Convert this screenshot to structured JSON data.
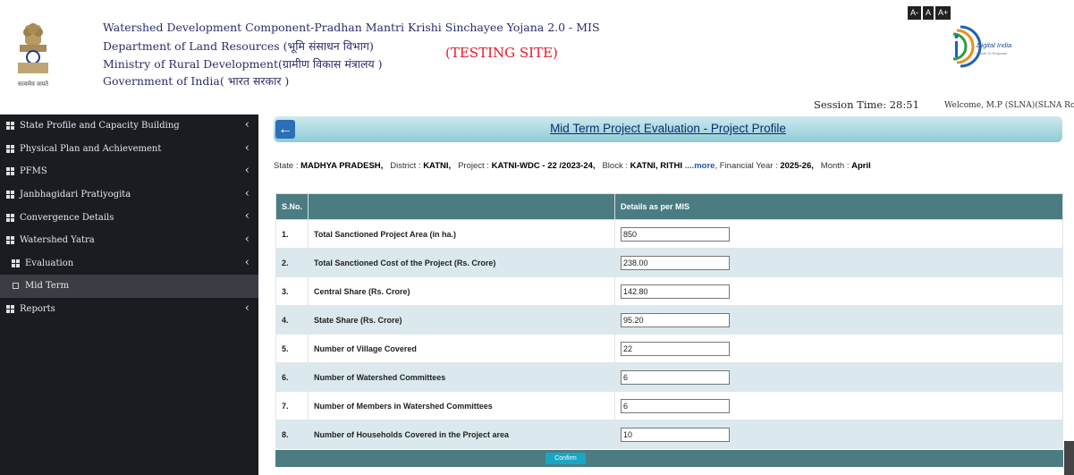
{
  "header": {
    "line1": "Watershed Development Component-Pradhan Mantri Krishi Sinchayee Yojana 2.0 - MIS",
    "line2": "Department of Land Resources (भूमि संसाधन विभाग)",
    "line3": "Ministry of Rural Development(ग्रामीण विकास मंत्रालय )",
    "line4": "Government of India( भारत सरकार )",
    "testing": "(TESTING SITE)",
    "emblem_caption": "सत्यमेव जयते",
    "font_buttons": [
      "A-",
      "A",
      "A+"
    ],
    "digital_india": "Digital India",
    "digital_india_tag": "Power To Empower",
    "session": "Session Time: 28:51",
    "welcome": "Welcome, M.P (SLNA)(SLNA Role) ▾"
  },
  "sidebar": {
    "items": [
      {
        "label": "State Profile and Capacity Building"
      },
      {
        "label": "Physical Plan and Achievement"
      },
      {
        "label": "PFMS"
      },
      {
        "label": "Janbhagidari Pratiyogita"
      },
      {
        "label": "Convergence Details"
      },
      {
        "label": "Watershed Yatra"
      },
      {
        "label": "Evaluation"
      },
      {
        "label": "Mid Term"
      },
      {
        "label": "Reports"
      }
    ]
  },
  "main": {
    "back_icon": "←",
    "title": "Mid Term Project Evaluation - Project Profile",
    "info": {
      "state_label": "State :",
      "state": "MADHYA PRADESH,",
      "district_label": "District :",
      "district": "KATNI,",
      "project_label": "Project :",
      "project": "KATNI-WDC - 22 /2023-24,",
      "block_label": "Block :",
      "block": "KATNI, RITHI",
      "more": "....more",
      "fy_label": ", Financial Year :",
      "fy": "2025-26,",
      "month_label": "Month :",
      "month": "April"
    },
    "table": {
      "headers": [
        "S.No.",
        "",
        "Details as per MIS"
      ],
      "rows": [
        {
          "sno": "1.",
          "label": "Total Sanctioned Project Area (in ha.)",
          "value": "850"
        },
        {
          "sno": "2.",
          "label": "Total Sanctioned Cost of the Project (Rs. Crore)",
          "value": "238.00"
        },
        {
          "sno": "3.",
          "label": "Central Share (Rs. Crore)",
          "value": "142.80"
        },
        {
          "sno": "4.",
          "label": "State Share (Rs. Crore)",
          "value": "95.20"
        },
        {
          "sno": "5.",
          "label": "Number of Village Covered",
          "value": "22"
        },
        {
          "sno": "6.",
          "label": "Number of Watershed Committees",
          "value": "6"
        },
        {
          "sno": "7.",
          "label": "Number of Members in Watershed Committees",
          "value": "6"
        },
        {
          "sno": "8.",
          "label": "Number of Households Covered in the Project area",
          "value": "10"
        }
      ]
    },
    "confirm": "Confirm"
  }
}
